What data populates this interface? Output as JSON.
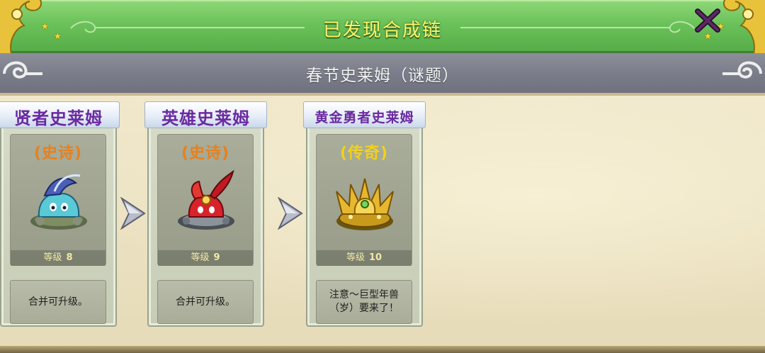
{
  "header": {
    "title": "已发现合成链",
    "close_icon": "close-x-icon",
    "accent_color": "#fff36a"
  },
  "subtitle": {
    "text": "春节史莱姆（谜题）"
  },
  "arrow_icon": "chevron-right-icon",
  "cards": [
    {
      "name": "贤者史莱姆",
      "rarity": "(史诗)",
      "rarity_color": "#e8801c",
      "level_label": "等级",
      "level": "8",
      "description": "合并可升级。",
      "sprite": "sage-slime-sprite"
    },
    {
      "name": "英雄史莱姆",
      "rarity": "(史诗)",
      "rarity_color": "#e8801c",
      "level_label": "等级",
      "level": "9",
      "description": "合并可升级。",
      "sprite": "hero-slime-sprite"
    },
    {
      "name": "黄金勇者史莱姆",
      "rarity": "(传奇)",
      "rarity_color": "#f0d11e",
      "level_label": "等级",
      "level": "10",
      "description": "注意～巨型年兽（岁）要来了！",
      "sprite": "golden-brave-slime-sprite"
    }
  ]
}
